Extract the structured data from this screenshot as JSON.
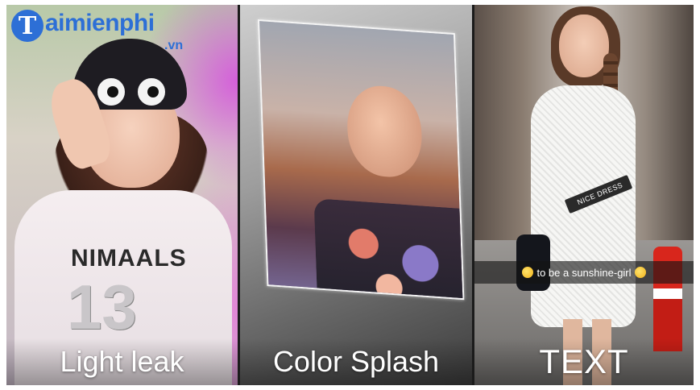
{
  "brand": {
    "logo_mark": "T",
    "logo_text": "aimienphi",
    "logo_suffix": ".vn",
    "color": "#2d6fd6"
  },
  "panels": [
    {
      "label": "Light leak",
      "shirt_print": "NIMAALS",
      "shirt_number": "13"
    },
    {
      "label": "Color Splash"
    },
    {
      "label": "TEXT",
      "sticker": "NICE DRESS",
      "caption": "to be a sunshine-girl"
    }
  ]
}
